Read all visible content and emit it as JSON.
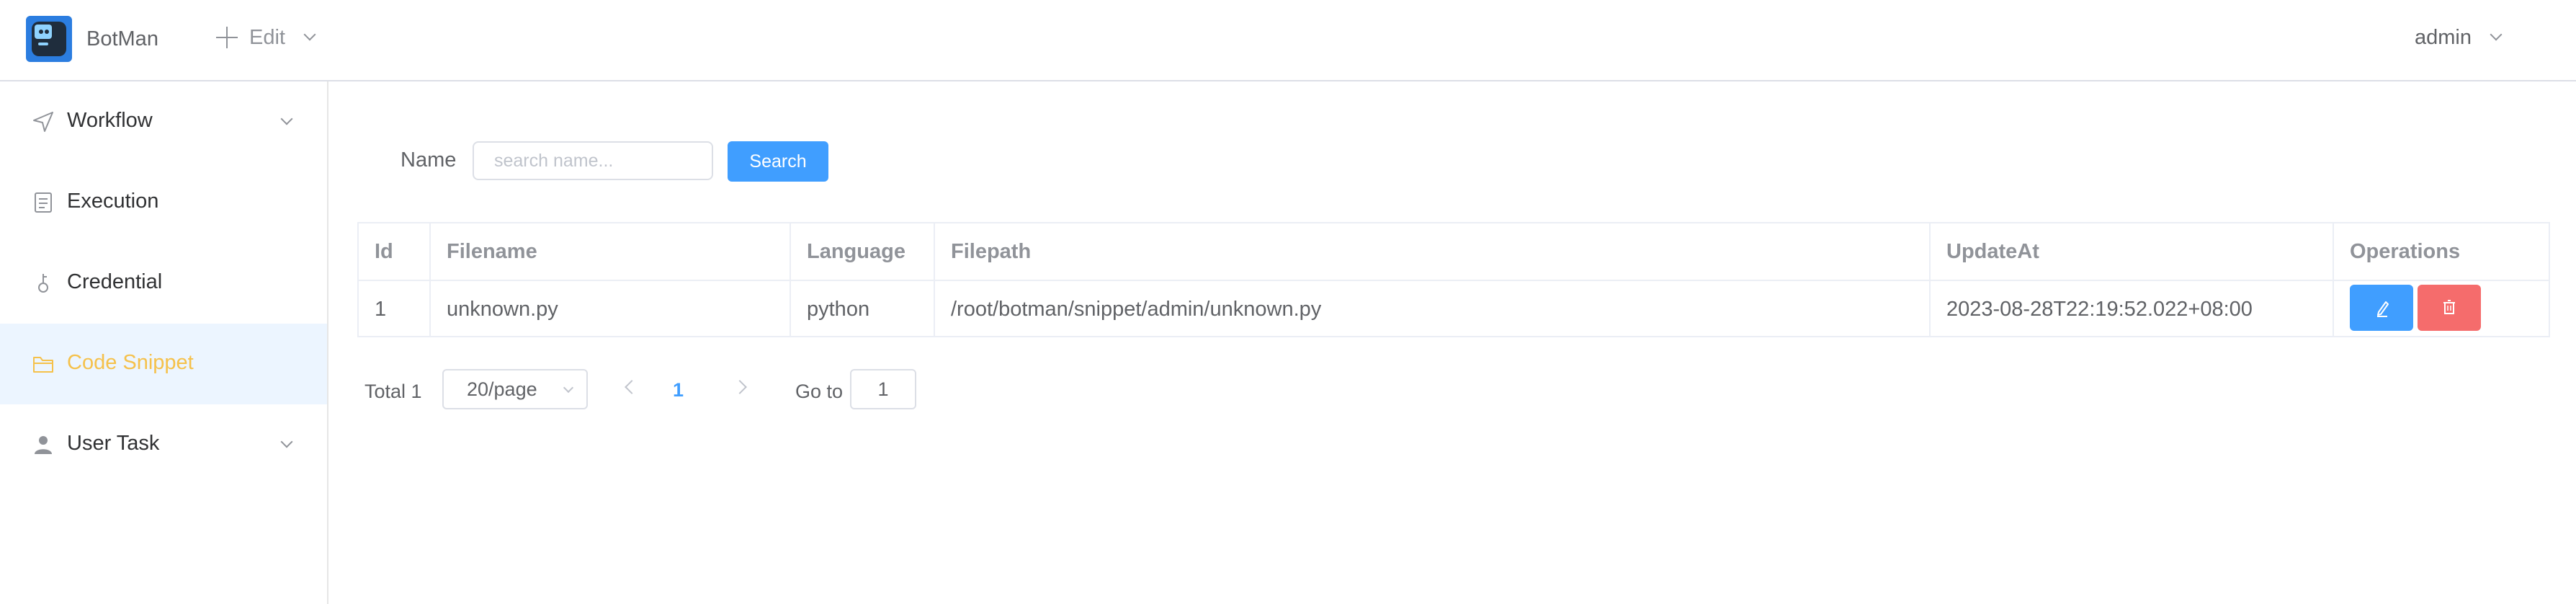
{
  "header": {
    "logo_icon": "robot-logo-icon",
    "brand": "BotMan",
    "edit_menu": {
      "icon": "plus-icon",
      "label": "Edit"
    },
    "user": {
      "label": "admin"
    }
  },
  "sidebar": {
    "items": [
      {
        "label": "Workflow",
        "icon": "send-icon",
        "expandable": true
      },
      {
        "label": "Execution",
        "icon": "document-icon"
      },
      {
        "label": "Credential",
        "icon": "key-icon"
      },
      {
        "label": "Code Snippet",
        "icon": "folder-icon",
        "active": true
      },
      {
        "label": "User Task",
        "icon": "user-icon",
        "expandable": true
      }
    ]
  },
  "search": {
    "label": "Name",
    "placeholder": "search name...",
    "value": "",
    "button": "Search"
  },
  "table": {
    "columns": [
      "Id",
      "Filename",
      "Language",
      "Filepath",
      "UpdateAt",
      "Operations"
    ],
    "rows": [
      {
        "id": "1",
        "filename": "unknown.py",
        "language": "python",
        "filepath": "/root/botman/snippet/admin/unknown.py",
        "update_at": "2023-08-28T22:19:52.022+08:00"
      }
    ],
    "operations": {
      "edit_icon": "pencil-icon",
      "delete_icon": "trash-icon"
    }
  },
  "pagination": {
    "total": "Total 1",
    "page_size": "20/page",
    "current_page": "1",
    "goto_label": "Go to",
    "goto_value": "1"
  },
  "colors": {
    "primary": "#409eff",
    "danger": "#f56c6c",
    "active_text": "#f5c14b",
    "active_bg": "#ecf5ff"
  }
}
